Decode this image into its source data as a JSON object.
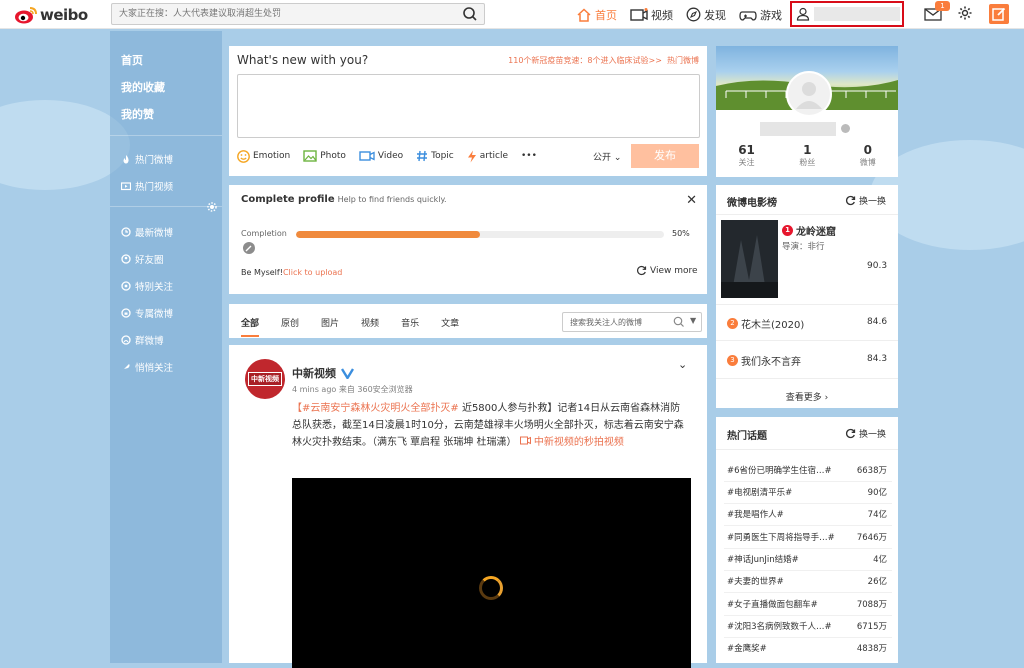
{
  "topbar": {
    "logo_text": "weibo",
    "search_placeholder": "大家正在搜：人大代表建议取消超生处罚",
    "nav": [
      {
        "label": "首页",
        "icon": "home-icon",
        "active": true
      },
      {
        "label": "视频",
        "icon": "video-icon",
        "active": false
      },
      {
        "label": "发现",
        "icon": "compass-icon",
        "active": false
      },
      {
        "label": "游戏",
        "icon": "gamepad-icon",
        "active": false
      }
    ],
    "mail_badge": "1",
    "accent": "#fa7d3c"
  },
  "leftnav": {
    "top_items": [
      "首页",
      "我的收藏",
      "我的赞"
    ],
    "mid_items": [
      "热门微博",
      "热门视频"
    ],
    "bottom_items": [
      "最新微博",
      "好友圈",
      "特别关注",
      "专属微博",
      "群微博",
      "悄悄关注"
    ]
  },
  "publisher": {
    "title": "What's new with you?",
    "hot_text": "110个新冠疫苗竞速：8个进入临床试验>>",
    "hot_link": "热门微博",
    "tools": [
      "Emotion",
      "Photo",
      "Video",
      "Topic",
      "article"
    ],
    "more": "•••",
    "scope": "公开",
    "submit": "发布"
  },
  "complete_profile": {
    "title": "Complete profile",
    "subtitle": "Help to find friends quickly.",
    "close": "✕",
    "completion_label": "Completion",
    "completion_pct_text": "50%",
    "completion_value": 0.5,
    "upload_prefix": "Be Myself!",
    "upload_link": "Click to upload",
    "view_more": "View more"
  },
  "feed_tabs": {
    "tabs": [
      "全部",
      "原创",
      "图片",
      "视频",
      "音乐",
      "文章"
    ],
    "search_placeholder": "搜索我关注人的微博"
  },
  "post": {
    "author": "中新视频",
    "avatar_text": "中新视频",
    "meta": "4 mins ago 来自 360安全浏览器",
    "body_tag": "【#云南安宁森林火灾明火全部扑灭#",
    "body_text": " 近5800人参与扑救】记者14日从云南省森林消防总队获悉，截至14日凌晨1时10分，云南楚雄禄丰火场明火全部扑灭，标志着云南安宁森林火灾扑救结束。（满东飞 覃启程 张瑞坤 杜瑞潇）",
    "body_link": "中新视频的秒拍视频"
  },
  "profile_card": {
    "stats": [
      {
        "num": "61",
        "label": "关注"
      },
      {
        "num": "1",
        "label": "粉丝"
      },
      {
        "num": "0",
        "label": "微博"
      }
    ]
  },
  "movies": {
    "title": "微博电影榜",
    "refresh": "换一换",
    "items": [
      {
        "rank": "1",
        "name": "龙岭迷窟",
        "director": "导演：非行",
        "score": "90.3"
      },
      {
        "rank": "2",
        "name": "花木兰(2020)",
        "score": "84.6"
      },
      {
        "rank": "3",
        "name": "我们永不言弃",
        "score": "84.3"
      }
    ],
    "see_more": "查看更多 ›"
  },
  "topics": {
    "title": "热门话题",
    "refresh": "换一换",
    "items": [
      {
        "name": "#6省份已明确学生住宿…#",
        "count": "6638万"
      },
      {
        "name": "#电视剧清平乐#",
        "count": "90亿"
      },
      {
        "name": "#我是唱作人#",
        "count": "74亿"
      },
      {
        "name": "#同勇医生下周将指导手…#",
        "count": "7646万"
      },
      {
        "name": "#神话JunJin结婚#",
        "count": "4亿"
      },
      {
        "name": "#夫妻的世界#",
        "count": "26亿"
      },
      {
        "name": "#女子直播做面包翻车#",
        "count": "7088万"
      },
      {
        "name": "#沈阳3名病例致数千人…#",
        "count": "6715万"
      },
      {
        "name": "#金鹰奖#",
        "count": "4838万"
      }
    ]
  }
}
